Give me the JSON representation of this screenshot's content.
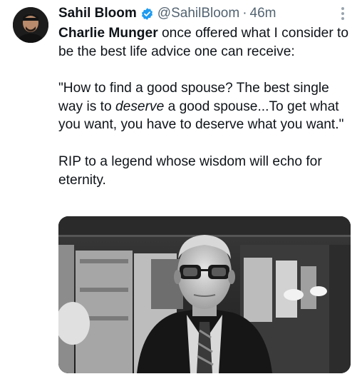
{
  "tweet": {
    "author": {
      "display_name": "Sahil Bloom",
      "handle": "@SahilBloom",
      "verified": true,
      "verified_color": "#1d9bf0"
    },
    "separator": "·",
    "timestamp": "46m",
    "body": {
      "line1_name": "Charlie Munger",
      "line1_rest": " once offered what I consider to be the best life advice one can receive:",
      "quote_part1": "\"How to find a good spouse? The best single way is to ",
      "quote_italic": "deserve",
      "quote_part2": " a good spouse...To get what you want, you have to deserve what you want.\"",
      "closing": "RIP to a legend whose wisdom will echo for eternity."
    },
    "media": {
      "icon": "photo-icon",
      "style": "black-and-white portrait"
    },
    "colors": {
      "text": "#0f1419",
      "secondary": "#536471"
    }
  }
}
